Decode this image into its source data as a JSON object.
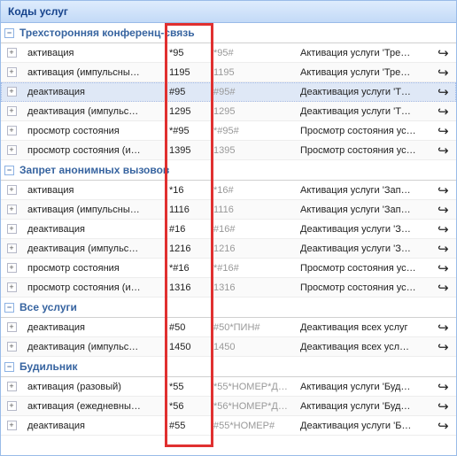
{
  "title": "Коды услуг",
  "groups": [
    {
      "name": "Трехсторонняя конференц-связь",
      "rows": [
        {
          "name": "активация",
          "code": "*95",
          "code2": "*95#",
          "desc": "Активация услуги 'Тре…",
          "selected": false
        },
        {
          "name": "активация (импульсны…",
          "code": "1195",
          "code2": "1195",
          "desc": "Активация услуги 'Тре…",
          "selected": false
        },
        {
          "name": "деактивация",
          "code": "#95",
          "code2": "#95#",
          "desc": "Деактивация услуги 'Т…",
          "selected": true
        },
        {
          "name": "деактивация (импульс…",
          "code": "1295",
          "code2": "1295",
          "desc": "Деактивация услуги 'Т…",
          "selected": false
        },
        {
          "name": "просмотр состояния",
          "code": "*#95",
          "code2": "*#95#",
          "desc": "Просмотр состояния ус…",
          "selected": false
        },
        {
          "name": "просмотр состояния (и…",
          "code": "1395",
          "code2": "1395",
          "desc": "Просмотр состояния ус…",
          "selected": false
        }
      ]
    },
    {
      "name": "Запрет анонимных вызовов",
      "rows": [
        {
          "name": "активация",
          "code": "*16",
          "code2": "*16#",
          "desc": "Активация услуги 'Зап…",
          "selected": false
        },
        {
          "name": "активация (импульсны…",
          "code": "1116",
          "code2": "1116",
          "desc": "Активация услуги 'Зап…",
          "selected": false
        },
        {
          "name": "деактивация",
          "code": "#16",
          "code2": "#16#",
          "desc": "Деактивация услуги 'З…",
          "selected": false
        },
        {
          "name": "деактивация (импульс…",
          "code": "1216",
          "code2": "1216",
          "desc": "Деактивация услуги 'З…",
          "selected": false
        },
        {
          "name": "просмотр состояния",
          "code": "*#16",
          "code2": "*#16#",
          "desc": "Просмотр состояния ус…",
          "selected": false
        },
        {
          "name": "просмотр состояния (и…",
          "code": "1316",
          "code2": "1316",
          "desc": "Просмотр состояния ус…",
          "selected": false
        }
      ]
    },
    {
      "name": "Все услуги",
      "rows": [
        {
          "name": "деактивация",
          "code": "#50",
          "code2": "#50*ПИН#",
          "desc": "Деактивация всех услуг",
          "selected": false
        },
        {
          "name": "деактивация (импульс…",
          "code": "1450",
          "code2": "1450",
          "desc": "Деактивация всех усл…",
          "selected": false
        }
      ]
    },
    {
      "name": "Будильник",
      "rows": [
        {
          "name": "активация (разовый)",
          "code": "*55",
          "code2": "*55*НОМЕР*Д…",
          "desc": "Активация услуги 'Буд…",
          "selected": false
        },
        {
          "name": "активация (ежедневны…",
          "code": "*56",
          "code2": "*56*НОМЕР*Д…",
          "desc": "Активация услуги 'Буд…",
          "selected": false
        },
        {
          "name": "деактивация",
          "code": "#55",
          "code2": "#55*НОМЕР#",
          "desc": "Деактивация услуги 'Б…",
          "selected": false
        }
      ]
    }
  ]
}
